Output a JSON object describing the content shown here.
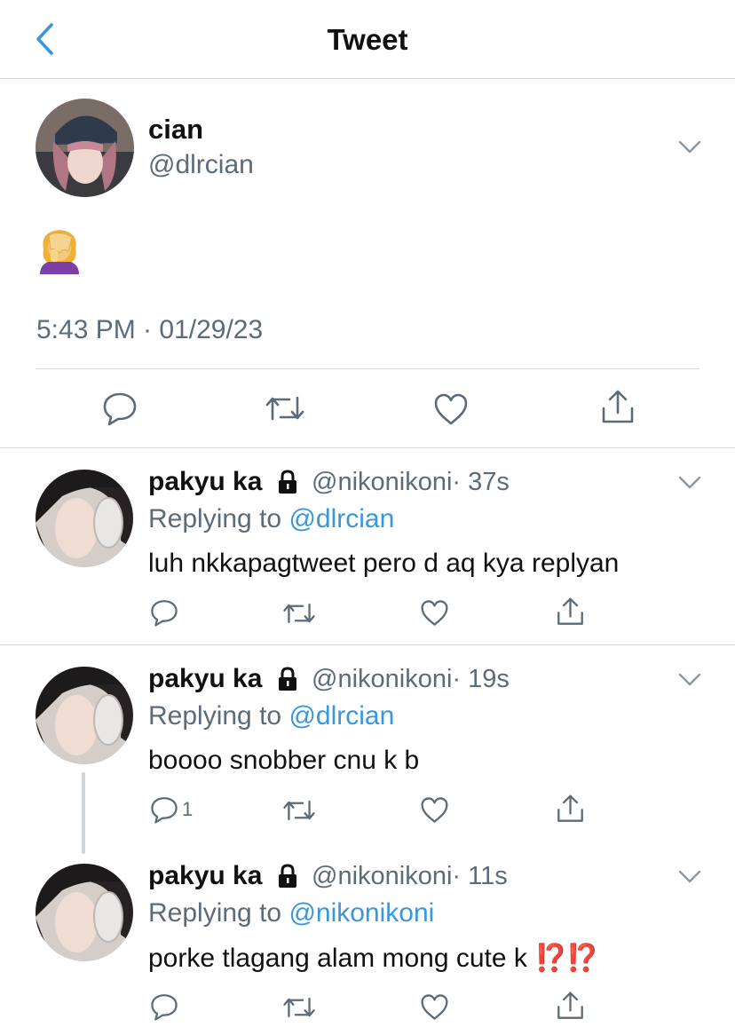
{
  "header": {
    "title": "Tweet"
  },
  "main_tweet": {
    "name": "cian",
    "handle": "@dlrcian",
    "emoji": "face-palm-emoji",
    "timestamp": "5:43 PM · 01/29/23"
  },
  "replies": [
    {
      "name": "pakyu ka",
      "handle": "@nikonikoni",
      "time": "· 37s",
      "replying_prefix": "Replying to ",
      "replying_to": "@dlrcian",
      "text": "luh nkkapagtweet pero d aq kya replyan",
      "reply_count": ""
    },
    {
      "name": "pakyu ka",
      "handle": "@nikonikoni",
      "time": "· 19s",
      "replying_prefix": "Replying to ",
      "replying_to": "@dlrcian",
      "text": "boooo snobber cnu k b",
      "reply_count": "1"
    },
    {
      "name": "pakyu ka",
      "handle": "@nikonikoni",
      "time": "· 11s",
      "replying_prefix": "Replying to ",
      "replying_to": "@nikonikoni",
      "text": "porke tlagang alam mong cute k ",
      "text_emoji": "⁉️⁉️",
      "reply_count": ""
    }
  ],
  "icons": {
    "back": "chevron-left-icon",
    "more": "chevron-down-icon",
    "reply": "speech-bubble-icon",
    "retweet": "retweet-icon",
    "like": "heart-icon",
    "share": "share-icon",
    "lock": "lock-icon"
  },
  "colors": {
    "accent": "#3a96dd",
    "text_secondary": "#5b6b78",
    "icon_gray": "#5b6b78",
    "divider": "#d5d9dc",
    "interrobang": "#d8401f"
  }
}
